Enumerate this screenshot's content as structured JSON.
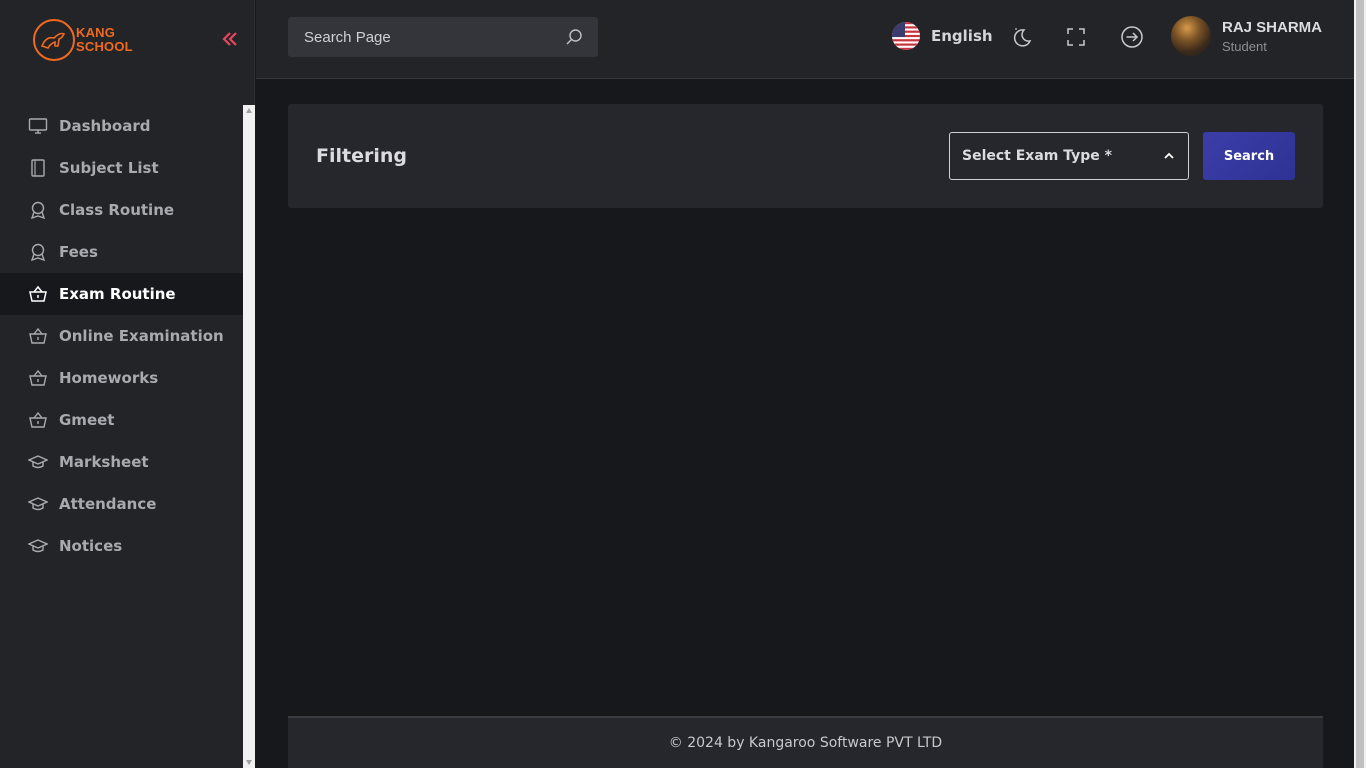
{
  "brand": {
    "line1": "KANG",
    "line2": "SCHOOL",
    "color": "#ef6a1f"
  },
  "sidebar": {
    "collapse_icon": "double-chevron-left-icon",
    "items": [
      {
        "label": "Dashboard",
        "icon": "monitor-icon",
        "active": false
      },
      {
        "label": "Subject List",
        "icon": "book-icon",
        "active": false
      },
      {
        "label": "Class Routine",
        "icon": "award-icon",
        "active": false
      },
      {
        "label": "Fees",
        "icon": "award-icon",
        "active": false
      },
      {
        "label": "Exam Routine",
        "icon": "basket-icon",
        "active": true
      },
      {
        "label": "Online Examination",
        "icon": "basket-icon",
        "active": false
      },
      {
        "label": "Homeworks",
        "icon": "basket-icon",
        "active": false
      },
      {
        "label": "Gmeet",
        "icon": "basket-icon",
        "active": false
      },
      {
        "label": "Marksheet",
        "icon": "graduation-cap-icon",
        "active": false
      },
      {
        "label": "Attendance",
        "icon": "graduation-cap-icon",
        "active": false
      },
      {
        "label": "Notices",
        "icon": "graduation-cap-icon",
        "active": false
      }
    ]
  },
  "header": {
    "search_placeholder": "Search Page",
    "language": "English",
    "user": {
      "name": "RAJ SHARMA",
      "role": "Student"
    }
  },
  "filter": {
    "title": "Filtering",
    "select_placeholder": "Select Exam Type *",
    "search_label": "Search",
    "button_color": "#3b3ea8"
  },
  "footer": {
    "text": "© 2024 by Kangaroo Software PVT LTD"
  }
}
